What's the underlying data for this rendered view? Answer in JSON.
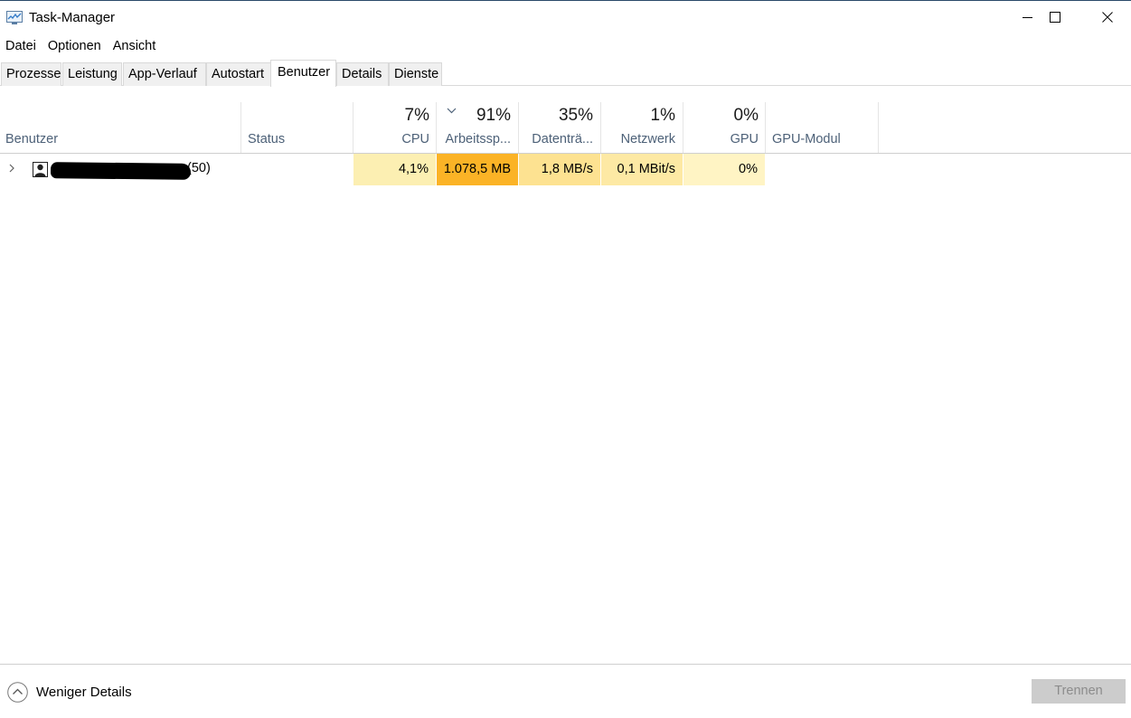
{
  "window": {
    "title": "Task-Manager",
    "controls": {
      "minimize": "minimize",
      "maximize": "maximize",
      "close": "close"
    }
  },
  "menu": [
    "Datei",
    "Optionen",
    "Ansicht"
  ],
  "tabs": [
    {
      "label": "Prozesse",
      "active": false
    },
    {
      "label": "Leistung",
      "active": false
    },
    {
      "label": "App-Verlauf",
      "active": false
    },
    {
      "label": "Autostart",
      "active": false
    },
    {
      "label": "Benutzer",
      "active": true
    },
    {
      "label": "Details",
      "active": false
    },
    {
      "label": "Dienste",
      "active": false
    }
  ],
  "columns": {
    "user": {
      "label": "Benutzer"
    },
    "status": {
      "label": "Status"
    },
    "cpu": {
      "label": "CPU",
      "percent": "7%"
    },
    "memory": {
      "label": "Arbeitssp...",
      "percent": "91%",
      "sorted": "descending"
    },
    "disk": {
      "label": "Datenträ...",
      "percent": "35%"
    },
    "network": {
      "label": "Netzwerk",
      "percent": "1%"
    },
    "gpu": {
      "label": "GPU",
      "percent": "0%"
    },
    "gpu_engine": {
      "label": "GPU-Modul"
    }
  },
  "rows": [
    {
      "user_suffix": "(50)",
      "name_redacted": true,
      "status": "",
      "cpu": "4,1%",
      "memory": "1.078,5 MB",
      "disk": "1,8 MB/s",
      "network": "0,1 MBit/s",
      "gpu": "0%",
      "gpu_engine": ""
    }
  ],
  "heat_colors": {
    "cpu": "#fcefb2",
    "memory": "#fbb326",
    "disk": "#fde291",
    "network": "#fde9a4",
    "gpu": "#fff4c4"
  },
  "footer": {
    "fewer_details": "Weniger Details",
    "end_button": "Trennen"
  }
}
